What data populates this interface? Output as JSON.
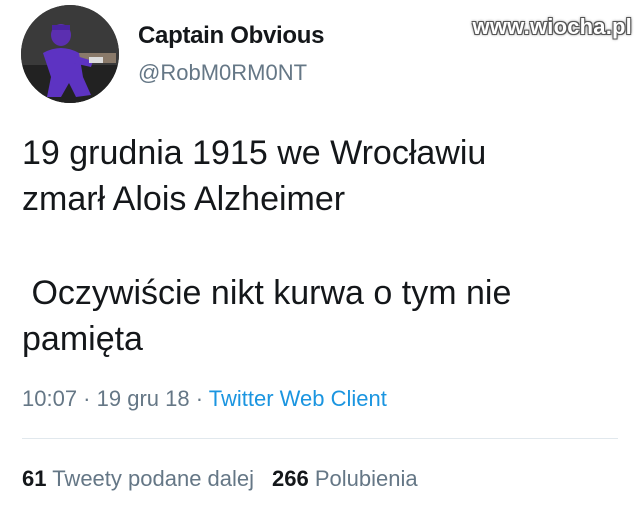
{
  "user": {
    "display_name": "Captain Obvious",
    "handle": "@RobM0RM0NT",
    "avatar_icon": "avatar-image"
  },
  "watermark": "www.wiocha.pl",
  "tweet": {
    "line1": "19 grudnia 1915 we Wrocławiu",
    "line2": "zmarł Alois Alzheimer",
    "line3": " Oczywiście nikt kurwa o tym nie",
    "line4": "pamięta"
  },
  "meta": {
    "time": "10:07",
    "sep1": " · ",
    "date": "19 gru 18",
    "sep2": " · ",
    "source": "Twitter Web Client"
  },
  "stats": {
    "retweets_count": "61",
    "retweets_label": "Tweety podane dalej",
    "likes_count": "266",
    "likes_label": "Polubienia"
  },
  "colors": {
    "text": "#14171a",
    "secondary": "#657786",
    "link": "#1b95e0",
    "divider": "#e1e8ed"
  }
}
